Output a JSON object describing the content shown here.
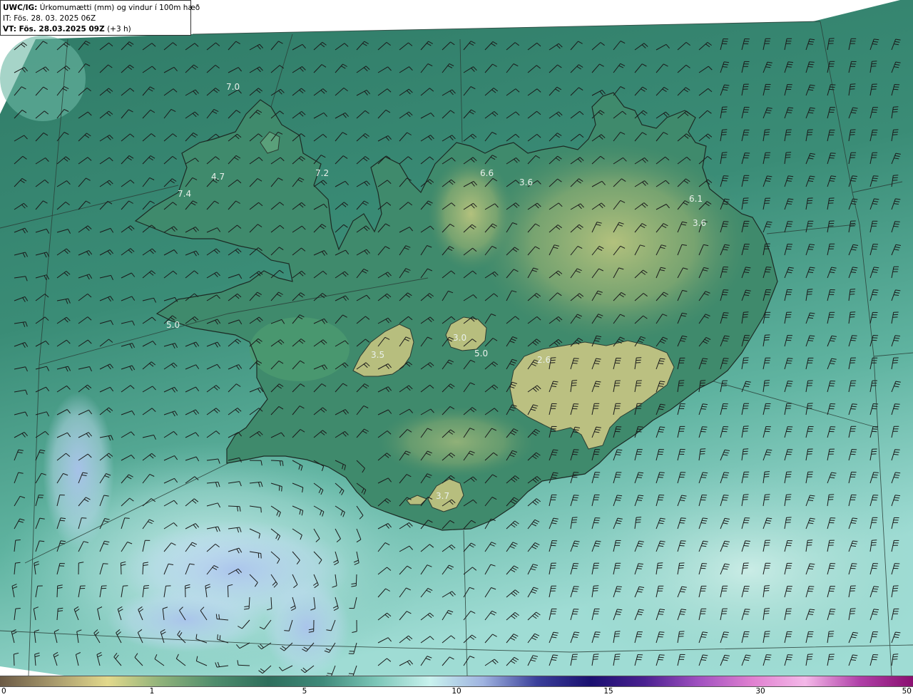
{
  "header": {
    "product": "UWC/IG:",
    "description": " Úrkomumætti (mm) og vindur í 100m hæð",
    "init_time": "IT: Fös. 28. 03. 2025 06Z",
    "valid_prefix": "VT: Fös. 28.03.2025 09Z",
    "valid_suffix": " (+3 h)"
  },
  "map_labels": [
    {
      "id": "pw-1",
      "text": "7.0"
    },
    {
      "id": "pw-2",
      "text": "4.7"
    },
    {
      "id": "pw-3",
      "text": "7.2"
    },
    {
      "id": "pw-4",
      "text": "7.4"
    },
    {
      "id": "pw-5",
      "text": "6.6"
    },
    {
      "id": "pw-6",
      "text": "3.6"
    },
    {
      "id": "pw-7",
      "text": "6.1"
    },
    {
      "id": "pw-8",
      "text": "3.6"
    },
    {
      "id": "pw-9",
      "text": "5.0"
    },
    {
      "id": "pw-10",
      "text": "3.0"
    },
    {
      "id": "pw-11",
      "text": "5.0"
    },
    {
      "id": "pw-12",
      "text": "3.5"
    },
    {
      "id": "pw-13",
      "text": "2.6"
    },
    {
      "id": "pw-14",
      "text": "3.7"
    }
  ],
  "colorbar": {
    "ticks": [
      "0",
      "1",
      "5",
      "10",
      "15",
      "30",
      "50"
    ],
    "colors": [
      "#6b5a45",
      "#a89a6c",
      "#e2d98c",
      "#8fb27a",
      "#4f8d6d",
      "#2e6e5c",
      "#3f8a7a",
      "#7cc6b8",
      "#c9f2ee",
      "#9fb3e0",
      "#3a3f9a",
      "#1a1070",
      "#4a2090",
      "#a050c0",
      "#e080d0",
      "#f4b8e8",
      "#b040a8",
      "#8a1070"
    ]
  }
}
